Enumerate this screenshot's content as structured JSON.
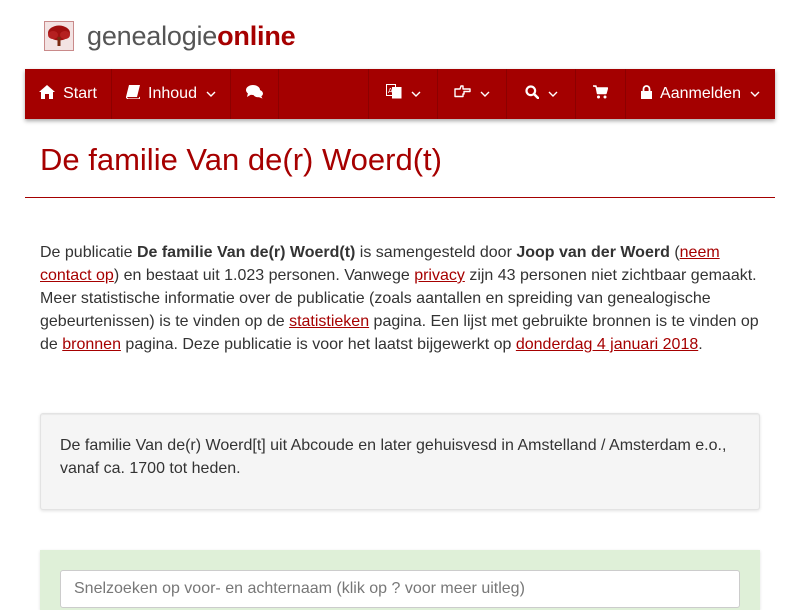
{
  "logo": {
    "icon": "family-tree-icon",
    "text_part1": "genealogie",
    "text_part2": "online"
  },
  "nav": {
    "start_label": "Start",
    "inhoud_label": "Inhoud",
    "login_label": "Aanmelden",
    "icons": [
      "home-icon",
      "book-icon",
      "comments-icon",
      "language-icon",
      "hand-pointer-icon",
      "search-icon",
      "shopping-cart-icon",
      "lock-icon",
      "chevron-down-icon"
    ]
  },
  "page": {
    "title": "De familie Van de(r) Woerd(t)"
  },
  "intro": {
    "t1": "De publicatie ",
    "pub_name": "De familie Van de(r) Woerd(t)",
    "t2": " is samengesteld door ",
    "author": "Joop van der Woerd",
    "t3": "(",
    "contact_link": "neem contact op",
    "t4": ") en bestaat uit 1.023 personen. Vanwege ",
    "privacy_link": "privacy",
    "t5": " zijn 43 personen niet zichtbaar gemaakt. Meer statistische informatie over de publicatie (zoals aantallen en spreiding van genealogische gebeurtenissen) is te vinden op de ",
    "stats_link": "statistieken",
    "t6": " pagina. Een lijst met gebruikte bronnen is te vinden op de ",
    "sources_link": "bronnen",
    "t7": " pagina. Deze publicatie is voor het laatst bijgewerkt op ",
    "date_link": "donderdag 4 januari 2018",
    "t8": "."
  },
  "description": "De familie Van de(r) Woerd[t] uit Abcoude en later gehuisvesd in Amstelland / Amsterdam e.o., vanaf ca. 1700 tot heden.",
  "search": {
    "placeholder": "Snelzoeken op voor- en achternaam (klik op ? voor meer uitleg)"
  },
  "colors": {
    "brand": "#a40000",
    "search_panel": "#dff0d8",
    "well": "#f5f5f5"
  }
}
